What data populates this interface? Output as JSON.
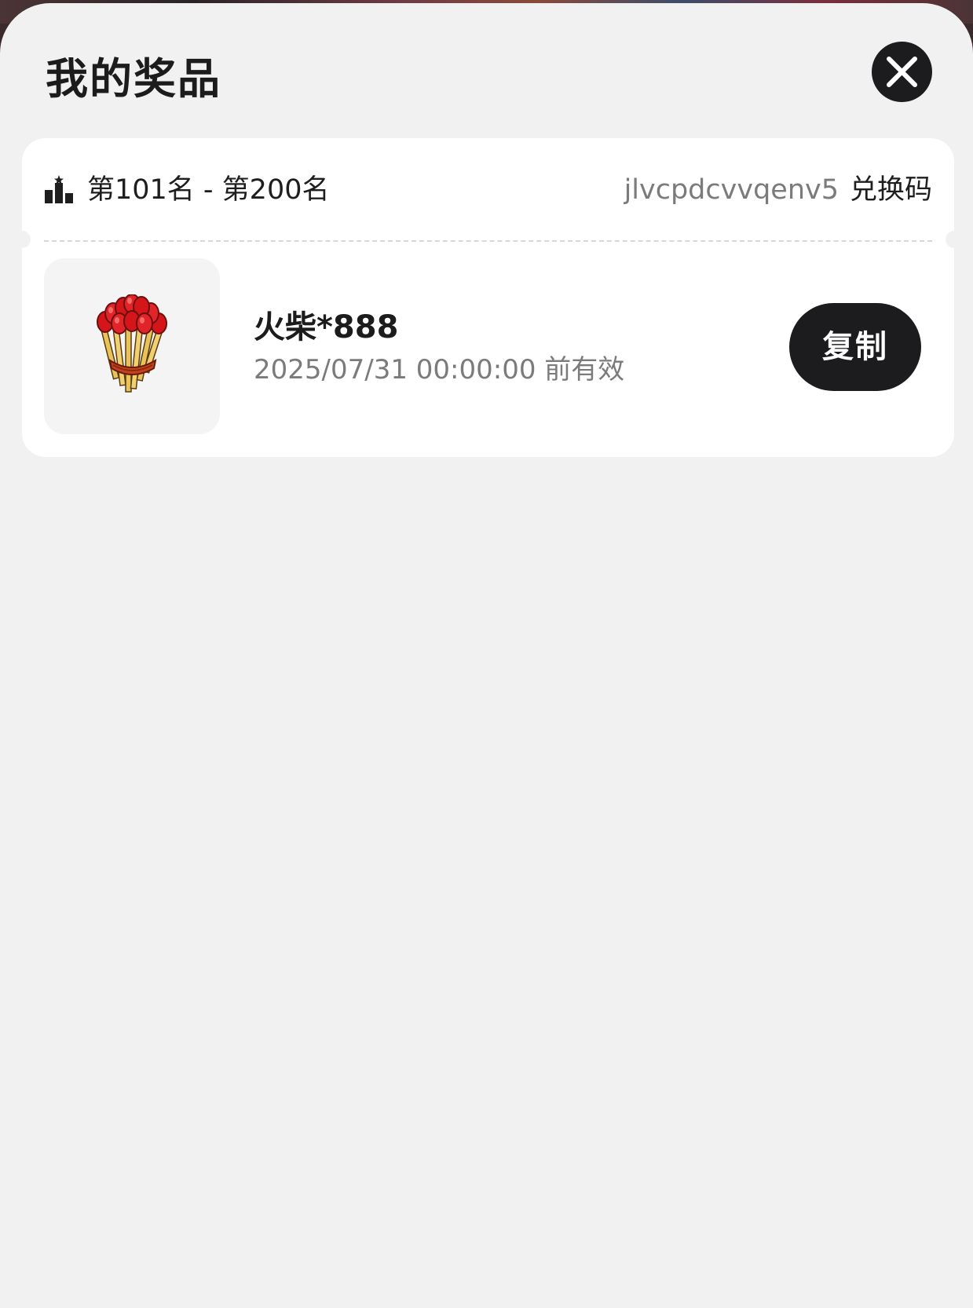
{
  "sheet": {
    "title": "我的奖品"
  },
  "close": {
    "icon": "close-icon"
  },
  "prize": {
    "rank_icon": "podium-icon",
    "rank": "第101名 - 第200名",
    "code": "jlvcpdcvvqenv5",
    "code_label": "兑换码",
    "thumbnail": "matches-bundle-image",
    "name": "火柴*888",
    "expiry": "2025/07/31 00:00:00 前有效",
    "copy_label": "复制"
  },
  "colors": {
    "sheet_bg": "#f1f1f1",
    "card_bg": "#ffffff",
    "primary_dark": "#1c1c1e",
    "muted_text": "#7b7b7b"
  }
}
